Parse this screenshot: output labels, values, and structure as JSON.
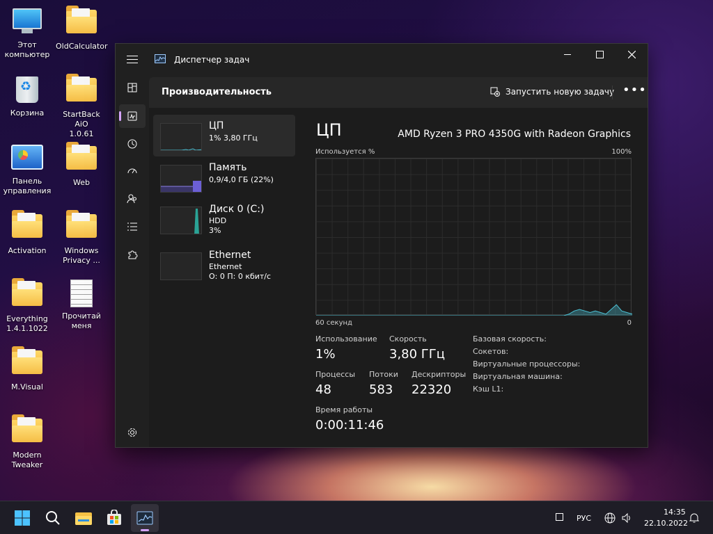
{
  "desktop": {
    "icons": [
      {
        "label": "Этот\nкомпьютер"
      },
      {
        "label": "Корзина"
      },
      {
        "label": "Панель\nуправления"
      },
      {
        "label": "Activation"
      },
      {
        "label": "Everything\n1.4.1.1022"
      },
      {
        "label": "M.Visual"
      },
      {
        "label": "Modern\nTweaker"
      },
      {
        "label": "OldCalculator"
      },
      {
        "label": "StartBack AiO\n1.0.61"
      },
      {
        "label": "Web"
      },
      {
        "label": "Windows\nPrivacy ..."
      },
      {
        "label": "Прочитай\nменя"
      }
    ]
  },
  "window": {
    "title": "Диспетчер задач",
    "page_title": "Производительность",
    "new_task_label": "Запустить новую задачу",
    "more_label": "•••"
  },
  "perf_list": [
    {
      "name": "ЦП",
      "sub1": "1%  3,80 ГГц",
      "sub2": ""
    },
    {
      "name": "Память",
      "sub1": "0,9/4,0 ГБ (22%)",
      "sub2": ""
    },
    {
      "name": "Диск 0 (C:)",
      "sub1": "HDD",
      "sub2": "3%"
    },
    {
      "name": "Ethernet",
      "sub1": "Ethernet",
      "sub2": "О: 0  П: 0 кбит/с"
    }
  ],
  "cpu": {
    "title": "ЦП",
    "model": "AMD Ryzen 3 PRO 4350G with Radeon Graphics",
    "graph_top_left": "Используется %",
    "graph_top_right": "100%",
    "graph_bottom_left": "60 секунд",
    "graph_bottom_right": "0",
    "usage_history": [
      0,
      0,
      0,
      0,
      0,
      0,
      0,
      0,
      0,
      0,
      0,
      0,
      0,
      0,
      0,
      0,
      0,
      0,
      0,
      0,
      0,
      0,
      0,
      0,
      0,
      0,
      0,
      0,
      0,
      0,
      0,
      0,
      0,
      0,
      0,
      0,
      0,
      0,
      0,
      0,
      0,
      0,
      0,
      0,
      0,
      0,
      0,
      0,
      1,
      3,
      4,
      3,
      2,
      3,
      2,
      1,
      4,
      7,
      3,
      2,
      1
    ],
    "stats": {
      "usage_label": "Использование",
      "usage_value": "1%",
      "speed_label": "Скорость",
      "speed_value": "3,80 ГГц",
      "processes_label": "Процессы",
      "processes_value": "48",
      "threads_label": "Потоки",
      "threads_value": "583",
      "handles_label": "Дескрипторы",
      "handles_value": "22320",
      "uptime_label": "Время работы",
      "uptime_value": "0:00:11:46"
    },
    "specs": [
      "Базовая скорость:",
      "Сокетов:",
      "Виртуальные процессоры:",
      "Виртуальная машина:",
      "Кэш L1:"
    ]
  },
  "taskbar": {
    "lang": "РУС",
    "time": "14:35",
    "date": "22.10.2022"
  },
  "colors": {
    "cpu_graph": "#4cc2d6",
    "memory_graph": "#8c7fe6",
    "disk_graph": "#3fc3b0",
    "ethernet_graph": "#d16a8a",
    "accent": "#d6a4ff"
  }
}
